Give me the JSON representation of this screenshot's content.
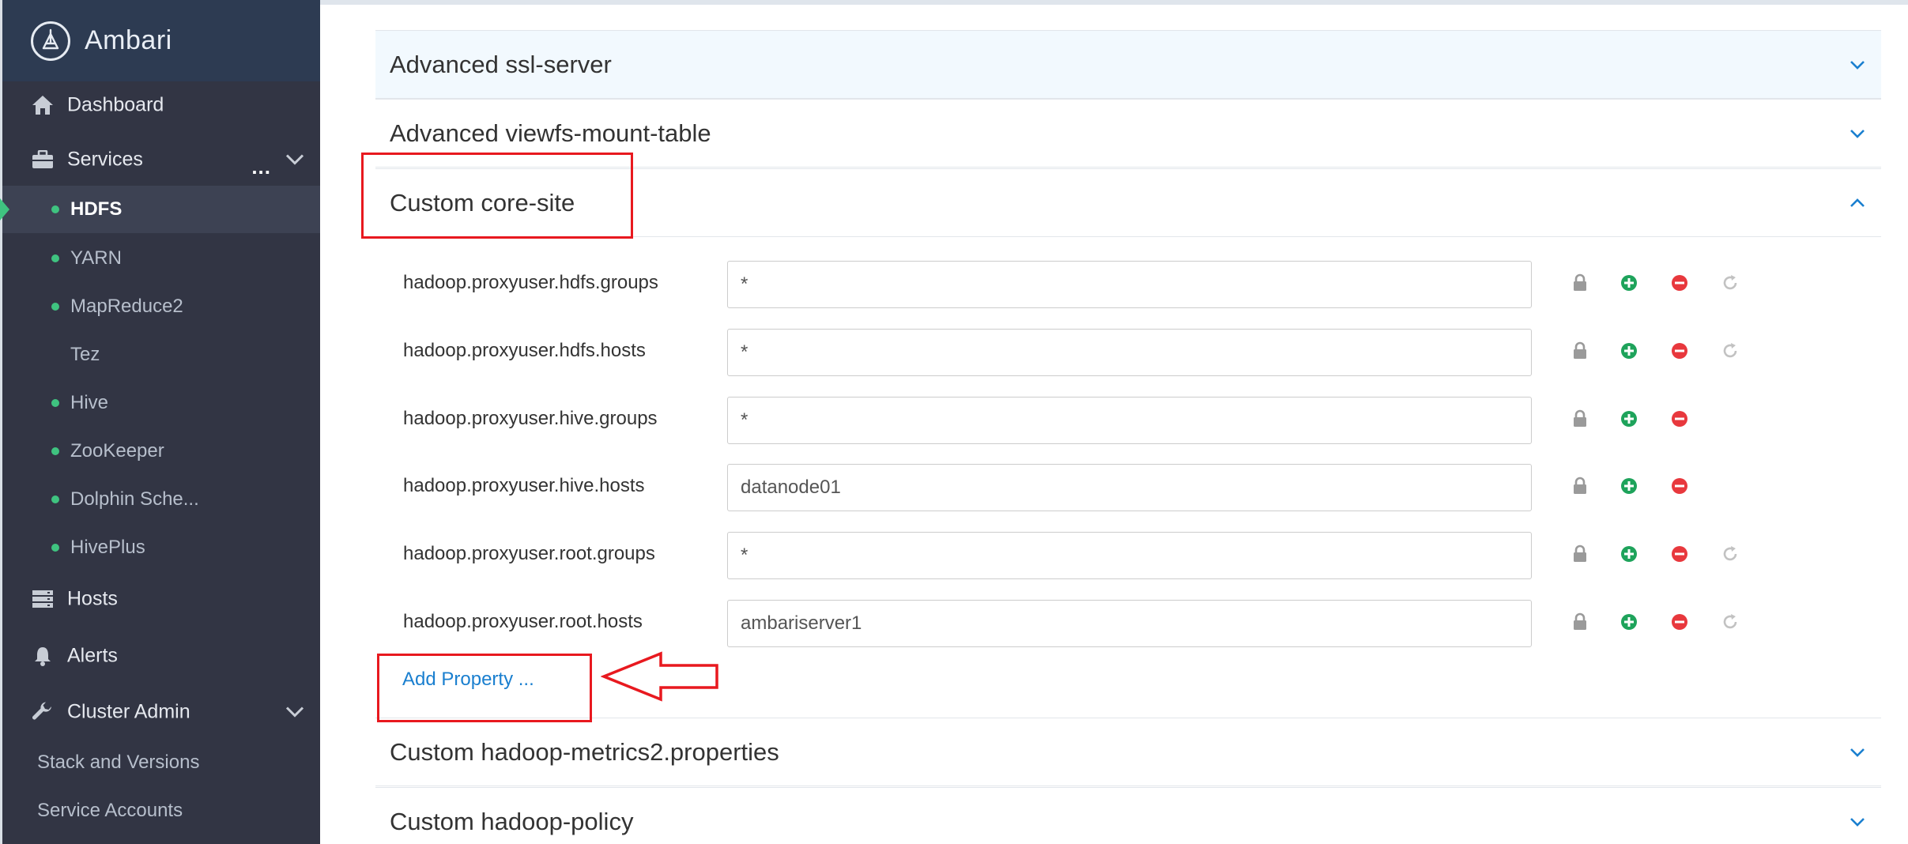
{
  "app": {
    "brand": "Ambari"
  },
  "sidebar": {
    "dashboard": "Dashboard",
    "services": "Services",
    "services_more": "...",
    "service_items": [
      {
        "label": "HDFS",
        "status_dot": true,
        "active": true
      },
      {
        "label": "YARN",
        "status_dot": true
      },
      {
        "label": "MapReduce2",
        "status_dot": true
      },
      {
        "label": "Tez",
        "status_dot": false
      },
      {
        "label": "Hive",
        "status_dot": true
      },
      {
        "label": "ZooKeeper",
        "status_dot": true
      },
      {
        "label": "Dolphin Sche...",
        "status_dot": true
      },
      {
        "label": "HivePlus",
        "status_dot": true
      }
    ],
    "hosts": "Hosts",
    "alerts": "Alerts",
    "cluster_admin": "Cluster Admin",
    "cluster_admin_items": [
      "Stack and Versions",
      "Service Accounts"
    ]
  },
  "sections": {
    "ssl_server": "Advanced ssl-server",
    "viewfs": "Advanced viewfs-mount-table",
    "core_site": "Custom core-site",
    "metrics2": "Custom hadoop-metrics2.properties",
    "policy": "Custom hadoop-policy"
  },
  "properties": [
    {
      "name": "hadoop.proxyuser.hdfs.groups",
      "value": "*",
      "undo": true
    },
    {
      "name": "hadoop.proxyuser.hdfs.hosts",
      "value": "*",
      "undo": true
    },
    {
      "name": "hadoop.proxyuser.hive.groups",
      "value": "*",
      "undo": false
    },
    {
      "name": "hadoop.proxyuser.hive.hosts",
      "value": "datanode01",
      "undo": false
    },
    {
      "name": "hadoop.proxyuser.root.groups",
      "value": "*",
      "undo": true
    },
    {
      "name": "hadoop.proxyuser.root.hosts",
      "value": "ambariserver1",
      "undo": true
    }
  ],
  "add_property": "Add Property ...",
  "colors": {
    "sidebar_bg": "#323544",
    "brand_bg": "#2d3b52",
    "status_green": "#3fc380",
    "add_green": "#1ea35b",
    "remove_red": "#e8383d",
    "link_blue": "#1a7fcf",
    "annotation_red": "#e8191f"
  },
  "icons": {
    "dashboard": "home-icon",
    "services": "briefcase-icon",
    "hosts": "server-icon",
    "alerts": "bell-icon",
    "cluster_admin": "wrench-icon",
    "lock": "lock-icon",
    "add": "plus-circle-icon",
    "remove": "minus-circle-icon",
    "undo": "undo-icon"
  }
}
